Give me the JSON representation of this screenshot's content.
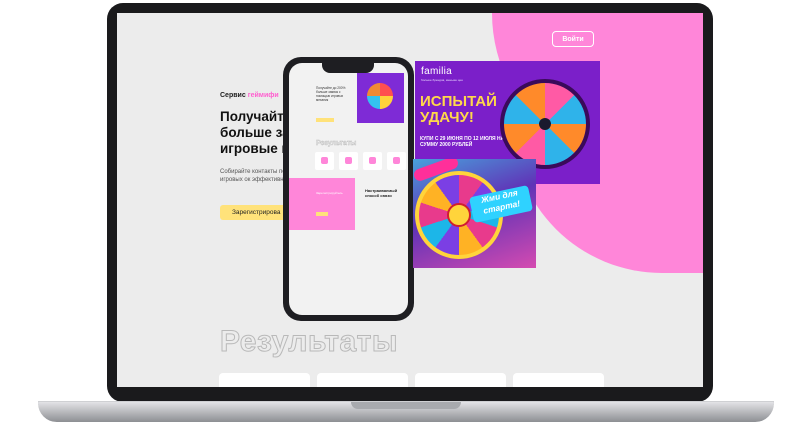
{
  "header": {
    "login_label": "Войти"
  },
  "hero": {
    "service_prefix": "Сервис",
    "service_accent": "геймифи",
    "headline": "Получайте больше за игровые в",
    "description": "Собирайте контакты помощью игровых ок эффективнее станд",
    "register_label": "Зарегистрирова"
  },
  "results": {
    "title": "Результаты"
  },
  "phone": {
    "hero_text": "Получайте до 200% больше заявок с помощью игровых механик",
    "results_title": "Результаты",
    "pink_text": "Зарегистрируйтесь",
    "customizable_label": "Настраиваемый способ связи"
  },
  "ad_familia": {
    "logo": "familia",
    "subtitle": "больше брендов, меньше цен",
    "slogan": "ИСПЫТАЙ УДАЧУ!",
    "promo": "КУПИ С 29 ИЮНЯ ПО 12 ИЮЛЯ НА СУММУ 2000 РУБЛЕЙ"
  },
  "ad_wheel": {
    "banner": "Жми для старта!"
  },
  "colors": {
    "accent_pink": "#ff86d9",
    "button_yellow": "#ffe27a",
    "purple": "#7b1fc9"
  }
}
